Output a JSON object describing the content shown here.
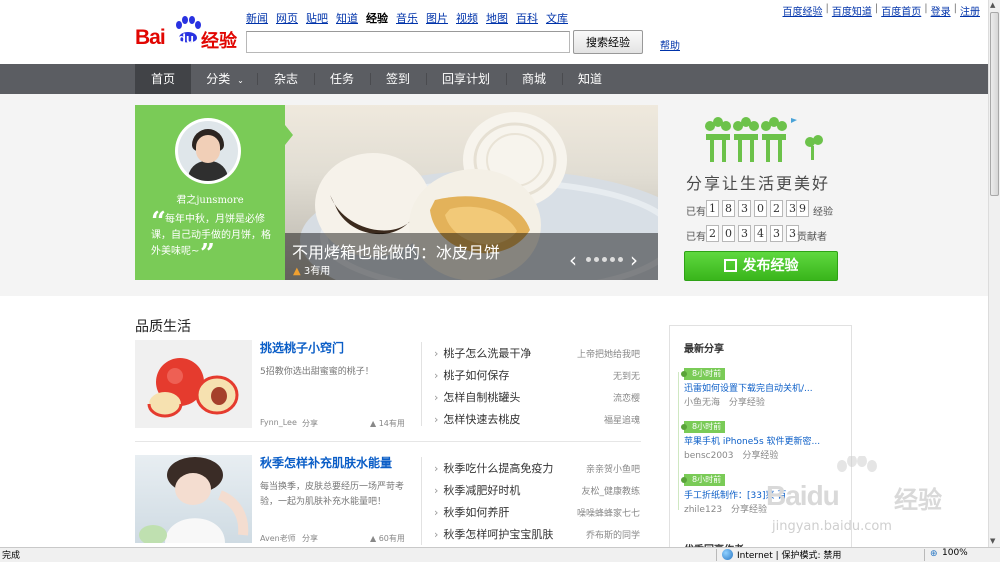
{
  "header": {
    "logo_text_bai": "Bai",
    "logo_text_du": "du",
    "logo_text_jingyan": "经验",
    "product_nav": [
      "新闻",
      "网页",
      "贴吧",
      "知道",
      "经验",
      "音乐",
      "图片",
      "视频",
      "地图",
      "百科",
      "文库"
    ],
    "search_placeholder": "",
    "search_button": "搜索经验",
    "help": "帮助",
    "user_links": [
      "百度经验",
      "百度知道",
      "百度首页",
      "登录",
      "注册"
    ]
  },
  "main_nav": [
    "首页",
    "分类",
    "杂志",
    "任务",
    "签到",
    "回享计划",
    "商城",
    "知道"
  ],
  "hero": {
    "author": "君之junsmore",
    "quote": "每年中秋，月饼是必修课，自己动手做的月饼，格外美味呢~",
    "title": "不用烤箱也能做的：冰皮月饼",
    "useful": "3有用"
  },
  "stats": {
    "slogan": "分享让生活更美好",
    "prefix1": "已有",
    "experiences_digits": [
      "1",
      "8",
      "3",
      "0",
      "2",
      "3",
      "9"
    ],
    "experiences_label": "经验",
    "prefix2": "已有",
    "contributors_digits": [
      "2",
      "0",
      "3",
      "4",
      "3",
      "3"
    ],
    "contributors_label": "贡献者",
    "publish_button": "发布经验"
  },
  "section_title": "品质生活",
  "articles": [
    {
      "title": "挑选桃子小窍门",
      "desc": "5招教你选出甜蜜蜜的桃子！",
      "author": "Fynn_Lee",
      "share": "分享",
      "useful": "14有用",
      "related": [
        {
          "title": "桃子怎么洗最干净",
          "user": "上帝把她给我吧"
        },
        {
          "title": "桃子如何保存",
          "user": "无到无"
        },
        {
          "title": "怎样自制桃罐头",
          "user": "流恋樱"
        },
        {
          "title": "怎样快速去桃皮",
          "user": "福星追魂"
        }
      ]
    },
    {
      "title": "秋季怎样补充肌肤水能量",
      "desc": "每当换季，皮肤总要经历一场严苛考验，一起为肌肤补充水能量吧！",
      "author": "Aven老师",
      "share": "分享",
      "useful": "60有用",
      "related": [
        {
          "title": "秋季吃什么提高免疫力",
          "user": "亲亲贺小鱼吧"
        },
        {
          "title": "秋季减肥好时机",
          "user": "友松_健康教练"
        },
        {
          "title": "秋季如何养肝",
          "user": "噪噪蜂蜂家七七"
        },
        {
          "title": "秋季怎样呵护宝宝肌肤",
          "user": "乔布斯的同学"
        }
      ]
    }
  ],
  "latest": {
    "title": "最新分享",
    "items": [
      {
        "time": "8小时前",
        "title": "迅雷如何设置下载完自动关机/...",
        "user": "小鱼无海",
        "share": "分享经验"
      },
      {
        "time": "8小时前",
        "title": "苹果手机 iPhone5s 软件更新密...",
        "user": "bensc2003",
        "share": "分享经验"
      },
      {
        "time": "8小时前",
        "title": "手工折纸制作：[33]菜 百 ...",
        "user": "zhile123",
        "share": "分享经验"
      }
    ],
    "next_section": "优秀回享作者"
  },
  "watermark": {
    "brand": "Baidu",
    "jingyan": "经验",
    "url": "jingyan.baidu.com"
  },
  "statusbar": {
    "left": "完成",
    "zone": "Internet | 保护模式: 禁用",
    "zoom": "100%"
  },
  "colors": {
    "brand_red": "#e10602",
    "nav_bg": "#5b5d62",
    "green": "#7acb57",
    "link_blue": "#0b5ec7"
  }
}
